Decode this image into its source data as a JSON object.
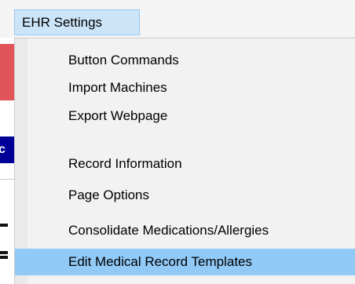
{
  "menubar": {
    "open_menu_label": "EHR Settings"
  },
  "background": {
    "fragment_text": "c"
  },
  "menu": {
    "items": [
      {
        "label": "Button Commands"
      },
      {
        "label": "Import Machines"
      },
      {
        "label": "Export Webpage"
      },
      {
        "label": "Record Information"
      },
      {
        "label": "Page Options"
      },
      {
        "label": "Consolidate Medications/Allergies"
      },
      {
        "label": "Edit Medical Record Templates",
        "highlighted": true
      }
    ]
  },
  "colors": {
    "menu_title_bg": "#cce4f7",
    "highlight_bg": "#91c9f7",
    "menu_bg": "#f2f2f2"
  }
}
